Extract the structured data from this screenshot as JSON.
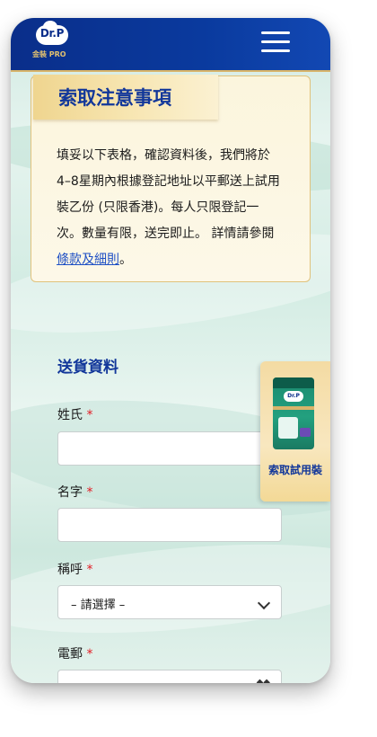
{
  "header": {
    "logo_text": "Dr.P",
    "logo_sub": "金裝 PRO",
    "menu_icon": "hamburger-menu-icon"
  },
  "notice": {
    "title": "索取注意事項",
    "body_text": "填妥以下表格，確認資料後，我們將於4–8星期內根據登記地址以平郵送上試用裝乙份 (只限香港)。每人只限登記一次。數量有限，送完即止。 詳情請參閱",
    "terms_link": "條款及細則",
    "end": "。"
  },
  "form": {
    "section_title": "送貨資料",
    "required_mark": "*",
    "surname_label": "姓氏",
    "surname_value": "",
    "given_name_label": "名字",
    "given_name_value": "",
    "title_label": "稱呼",
    "title_selected": "– 請選擇 –",
    "email_label": "電郵",
    "email_value": ""
  },
  "sample_tab": {
    "label": "索取試用裝",
    "pack_logo": "Dr.P"
  },
  "colors": {
    "brand_blue": "#12379a",
    "header_blue": "#0a2e8a",
    "gold": "#d8b46a",
    "required_red": "#e31b23"
  }
}
